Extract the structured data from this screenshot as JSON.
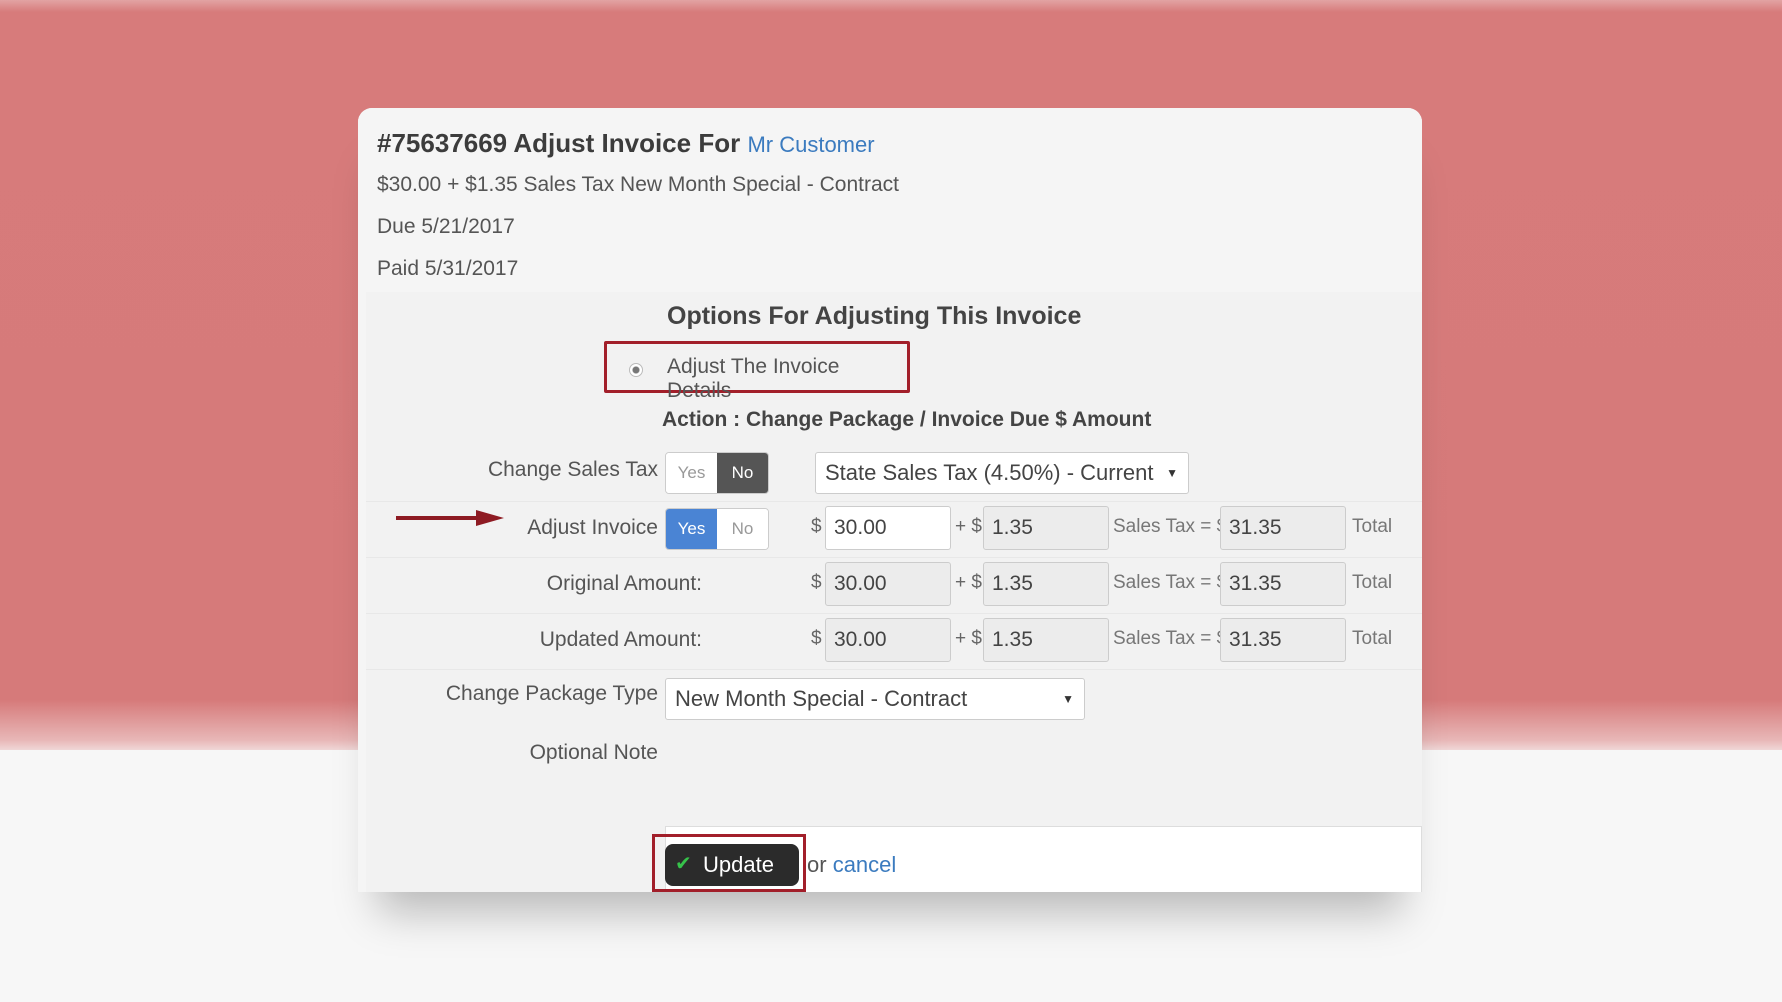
{
  "header": {
    "invoice_title": "#75637669 Adjust Invoice For",
    "customer": "Mr Customer",
    "summary": "$30.00 + $1.35 Sales Tax New Month Special - Contract",
    "due": "Due 5/21/2017",
    "paid": "Paid 5/31/2017"
  },
  "options": {
    "title": "Options For Adjusting This Invoice",
    "radio_label": "Adjust The Invoice Details",
    "action": "Action : Change Package / Invoice Due $ Amount"
  },
  "sales_tax": {
    "label": "Change Sales Tax",
    "yes": "Yes",
    "no": "No",
    "selected": "No",
    "select_value": "State Sales Tax (4.50%) - Current"
  },
  "adjust_invoice": {
    "label": "Adjust Invoice",
    "yes": "Yes",
    "no": "No",
    "selected": "Yes",
    "amount": "30.00",
    "tax": "1.35",
    "total": "31.35"
  },
  "original": {
    "label": "Original Amount:",
    "amount": "30.00",
    "tax": "1.35",
    "total": "31.35"
  },
  "updated": {
    "label": "Updated Amount:",
    "amount": "30.00",
    "tax": "1.35",
    "total": "31.35"
  },
  "shared": {
    "dollar": "$",
    "plus_dollar": "+ $",
    "sales_tax_eq": "Sales Tax = $",
    "total_word": "Total"
  },
  "package": {
    "label": "Change Package Type",
    "value": "New Month Special - Contract"
  },
  "note": {
    "label": "Optional Note",
    "value": ""
  },
  "actions": {
    "update": "Update",
    "or": "or",
    "cancel": "cancel"
  },
  "colors": {
    "accent_red": "#a21f2a",
    "link_blue": "#3b7bbf",
    "toggle_blue": "#4a84d4",
    "bg_red": "#d67a7a"
  }
}
